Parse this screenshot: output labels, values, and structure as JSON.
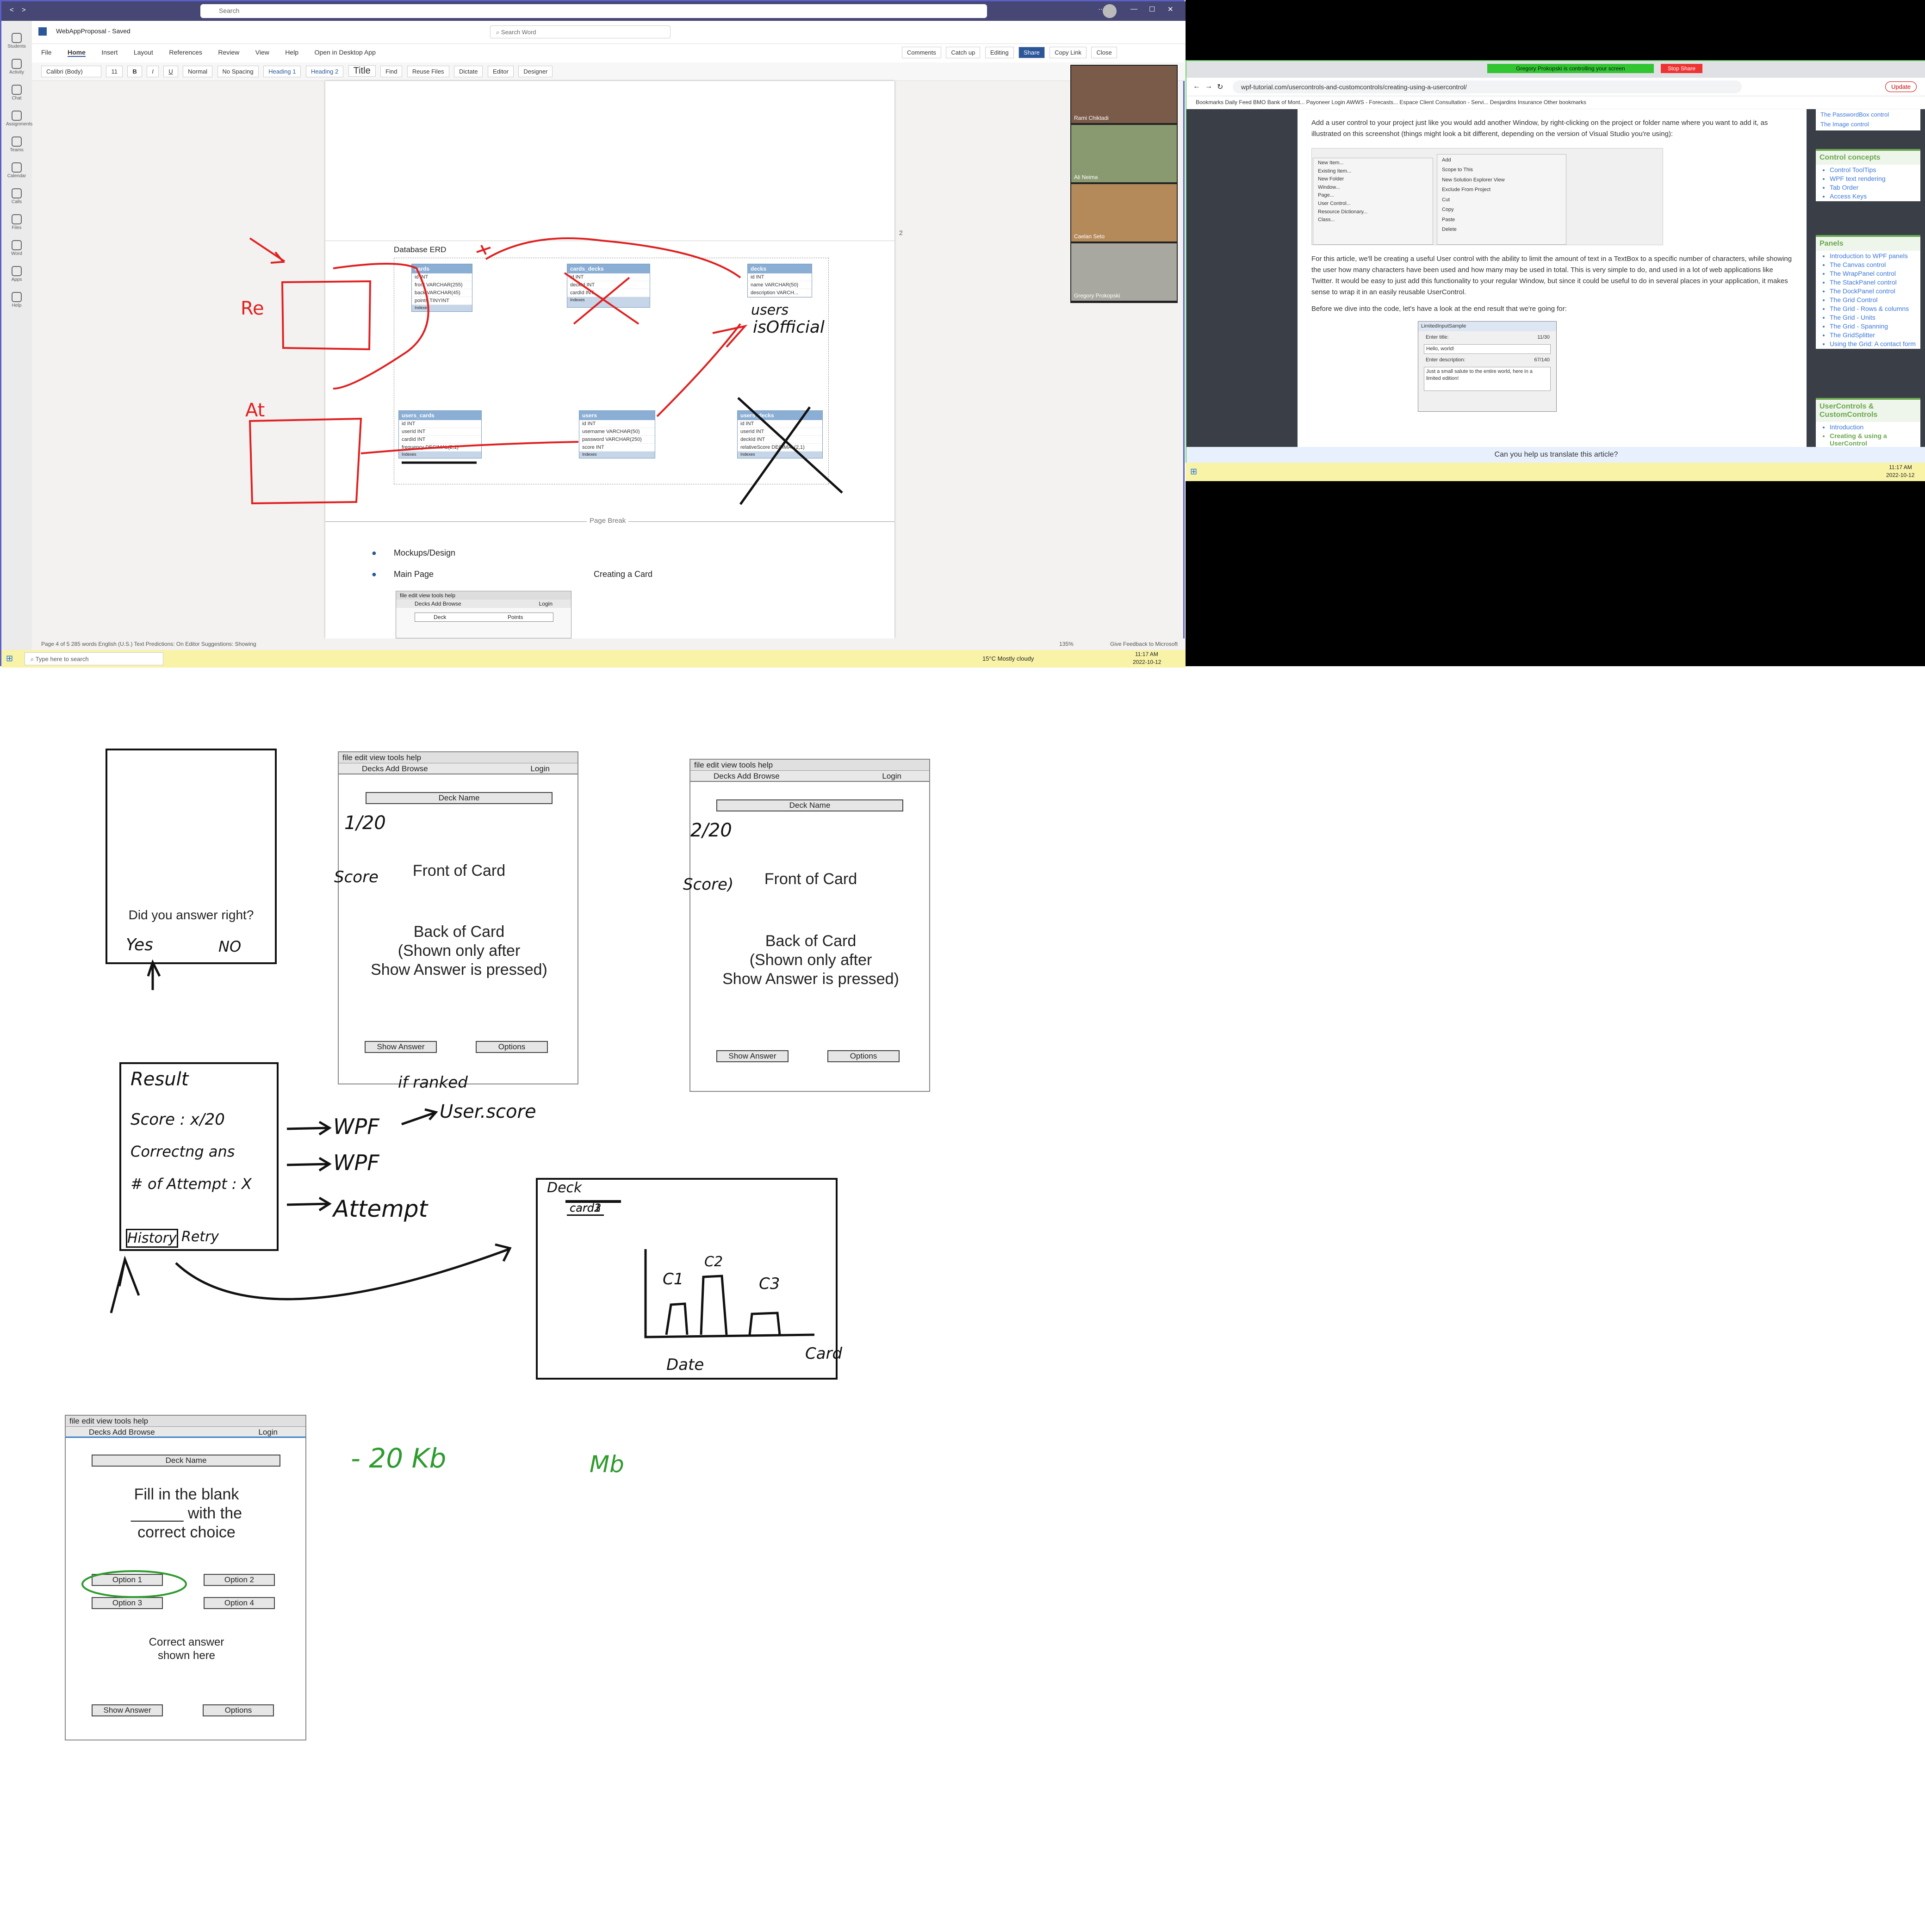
{
  "teams": {
    "search_placeholder": "Search",
    "word_title": "WebAppProposal - Saved",
    "search_word": "Search Word",
    "menu": [
      "File",
      "Home",
      "Insert",
      "Layout",
      "References",
      "Review",
      "View",
      "Help",
      "Open in Desktop App"
    ],
    "ribbon": {
      "font": "Calibri (Body)",
      "size": "11",
      "styles": [
        "Normal",
        "No Spacing",
        "Heading 1",
        "Heading 2",
        "Title"
      ],
      "find": "Find",
      "reuse": "Reuse Files",
      "dictate": "Dictate",
      "editor": "Editor",
      "designer": "Designer"
    },
    "top_buttons": [
      "Comments",
      "Catch up",
      "Editing",
      "Share",
      "Copy Link",
      "Close"
    ],
    "rail": [
      "Students",
      "Activity",
      "Chat",
      "Assignments",
      "Teams",
      "Calendar",
      "Calls",
      "Files",
      "Word",
      "Apps",
      "Help"
    ],
    "participants": [
      "Rami Chiktadi",
      "Ali Neima",
      "Caelan Seto",
      "Gregory Prokopski"
    ],
    "statusbar": "Page 4 of 5     285 words     English (U.S.)     Text Predictions: On     Editor Suggestions: Showing",
    "zoom": "135%",
    "feedback": "Give Feedback to Microsoft",
    "taskbar_search": "Type here to search",
    "weather": "15°C  Mostly cloudy",
    "clock": "11:17 AM",
    "date": "2022-10-12",
    "page_number": "2",
    "page_break": "Page Break"
  },
  "erd": {
    "title": "Database ERD",
    "tables": [
      {
        "name": "cards",
        "rows": [
          "id INT",
          "front VARCHAR(255)",
          "back VARCHAR(45)",
          "points TINYINT"
        ],
        "footer": "Indexes"
      },
      {
        "name": "cards_decks",
        "rows": [
          "id INT",
          "deckId INT",
          "cardId INT"
        ],
        "footer": "Indexes"
      },
      {
        "name": "decks",
        "rows": [
          "id INT",
          "name VARCHAR(50)",
          "description VARCH..."
        ],
        "footer": "Indexes"
      },
      {
        "name": "users_cards",
        "rows": [
          "id INT",
          "userId INT",
          "cardId INT",
          "frequency DECIMAL(2,1)"
        ],
        "footer": "Indexes"
      },
      {
        "name": "users",
        "rows": [
          "id INT",
          "username VARCHAR(50)",
          "password VARCHAR(250)",
          "score INT"
        ],
        "footer": "Indexes"
      },
      {
        "name": "users_decks",
        "rows": [
          "id INT",
          "userId INT",
          "deckId INT",
          "relativeScore DECIMAL(2,1)"
        ],
        "footer": "Indexes"
      }
    ],
    "annotations": {
      "re": "Re",
      "at": "At",
      "isofficial": "isOfficial",
      "users": "users"
    }
  },
  "doc_list": {
    "item1": "Mockups/Design",
    "item2": "Main Page",
    "creating": "Creating a Card",
    "mini_menu": "file  edit  view  tools  help",
    "mini_menu2": "Decks  Add  Browse",
    "login": "Login",
    "deck": "Deck",
    "points": "Points"
  },
  "browser": {
    "banner": "Gregory Prokopski is controlling your screen",
    "stop": "Stop Share",
    "url": "wpf-tutorial.com/usercontrols-and-customcontrols/creating-using-a-usercontrol/",
    "bookmarks": "Bookmarks   Daily Feed   BMO Bank of Mont...   Payoneer Login   AWWS - Forecasts...   Espace Client   Consultation - Servi...   Desjardins Insurance   Other bookmarks",
    "para1": "Add a user control to your project just like you would add another Window, by right-clicking on the project or folder name where you want to add it, as illustrated on this screenshot (things might look a bit different, depending on the version of Visual Studio you're using):",
    "para2": "For this article, we'll be creating a useful User control with the ability to limit the amount of text in a TextBox to a specific number of characters, while showing the user how many characters have been used and how many may be used in total. This is very simple to do, and used in a lot of web applications like Twitter. It would be easy to just add this functionality to your regular Window, but since it could be useful to do in several places in your application, it makes sense to wrap it in an easily reusable UserControl.",
    "para3": "Before we dive into the code, let's have a look at the end result that we're going for:",
    "ctx_left": [
      "New Item...",
      "Existing Item...",
      "New Folder",
      "Window...",
      "Page...",
      "User Control...",
      "Resource Dictionary...",
      "Class..."
    ],
    "ctx_right": [
      "Add",
      "Scope to This",
      "New Solution Explorer View",
      "Exclude From Project",
      "Cut",
      "Copy",
      "Paste",
      "Delete"
    ],
    "sample_title": "LimitedInputSample",
    "sample": {
      "l1": "Enter title:",
      "c1": "11/30",
      "v1": "Hello, world!",
      "l2": "Enter description:",
      "c2": "67/140",
      "v2": "Just a small salute to the entire world, here in a limited edition!"
    },
    "side_top": [
      "The PasswordBox control",
      "The Image control"
    ],
    "control_concepts": {
      "title": "Control concepts",
      "items": [
        "Control ToolTips",
        "WPF text rendering",
        "Tab Order",
        "Access Keys"
      ]
    },
    "panels": {
      "title": "Panels",
      "items": [
        "Introduction to WPF panels",
        "The Canvas control",
        "The WrapPanel control",
        "The StackPanel control",
        "The DockPanel control",
        "The Grid Control",
        "The Grid - Rows & columns",
        "The Grid - Units",
        "The Grid - Spanning",
        "The GridSplitter",
        "Using the Grid: A contact form"
      ]
    },
    "usercontrols": {
      "title": "UserControls & CustomControls",
      "items": [
        "Introduction",
        "Creating & using a UserControl"
      ]
    },
    "translate": "Can you help us translate this article?",
    "update": "Update",
    "clock": "11:17 AM",
    "date": "2022-10-12"
  },
  "wire1": {
    "question": "Did you answer right?",
    "yes": "Yes",
    "no": "NO"
  },
  "wire2": {
    "menu": "file  edit  view  tools  help",
    "menu2": "Decks   Add   Browse",
    "login": "Login",
    "deck": "Deck Name",
    "front": "Front of Card",
    "back": "Back of Card\n(Shown only after\nShow Answer is pressed)",
    "show": "Show Answer",
    "options": "Options",
    "count": "1/20",
    "score": "Score"
  },
  "wire3": {
    "menu": "file  edit  view  tools  help",
    "menu2": "Decks   Add   Browse",
    "login": "Login",
    "deck": "Deck Name",
    "front": "Front of Card",
    "back": "Back of Card\n(Shown only after\nShow Answer is pressed)",
    "show": "Show Answer",
    "options": "Options",
    "count": "2/20",
    "score": "Score)"
  },
  "result": {
    "title": "Result",
    "score": "Score : x/20",
    "correct": "Correctng ans",
    "attempt": "# of Attempt : X",
    "history": "History",
    "retry": "Retry",
    "wpf1": "WPF",
    "wpf2": "WPF",
    "att": "Attempt",
    "iframed": "if ranked",
    "userscore": "User.score"
  },
  "deckchart": {
    "deck": "Deck",
    "cards": [
      "card1",
      "card2",
      "card3"
    ],
    "c1": "C1",
    "c2": "C2",
    "c3": "C3",
    "x": "Date",
    "y": "Card"
  },
  "wire4": {
    "menu": "file  edit  view  tools  help",
    "menu2": "Decks   Add   Browse",
    "login": "Login",
    "deck": "Deck Name",
    "question": "Fill in the blank\n______ with the\ncorrect choice",
    "opt1": "Option 1",
    "opt2": "Option 2",
    "opt3": "Option 3",
    "opt4": "Option 4",
    "answer": "Correct answer\nshown here",
    "show": "Show Answer",
    "options": "Options"
  },
  "green_note": {
    "n1": "- 20 Kb",
    "n2": "Mb"
  }
}
